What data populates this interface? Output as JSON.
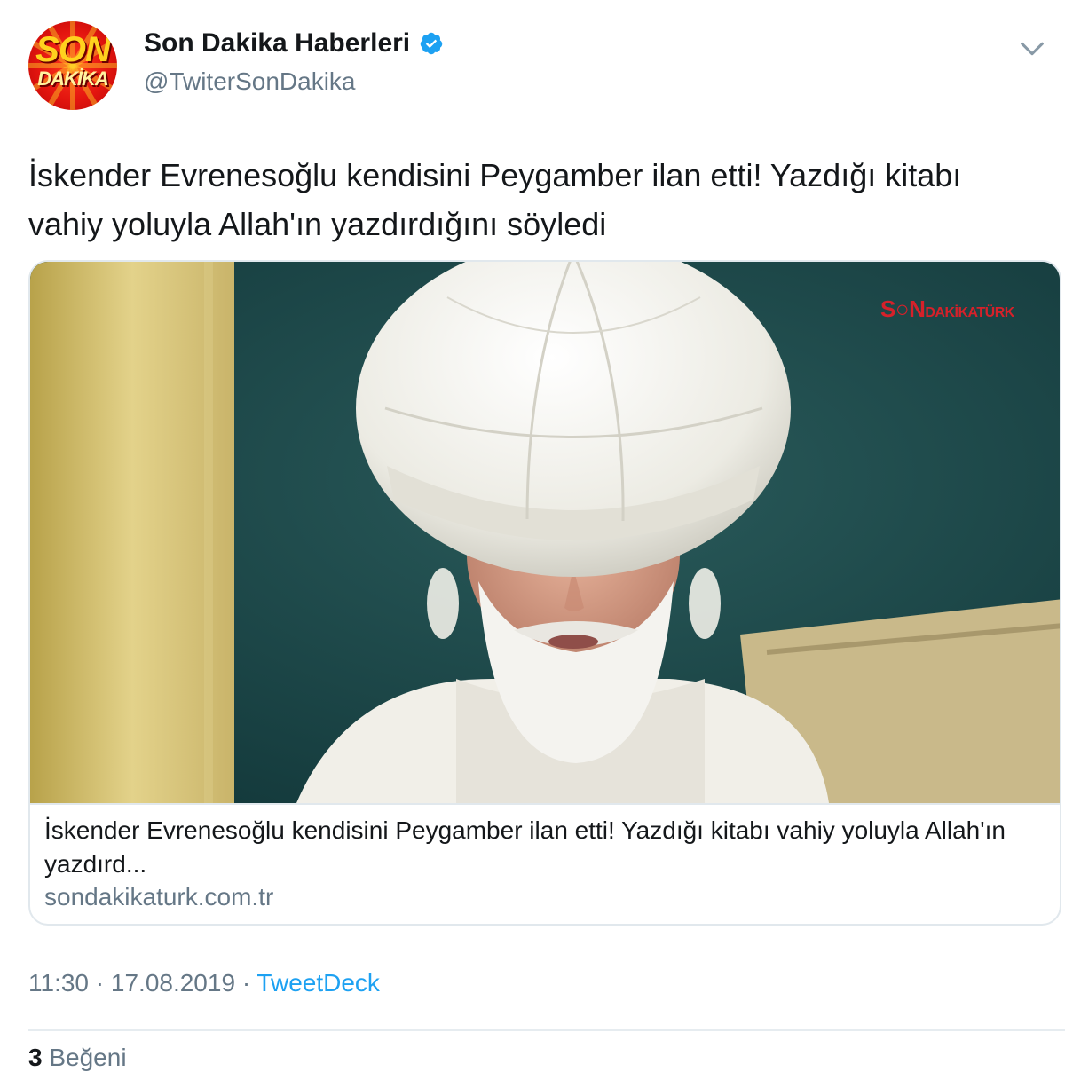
{
  "tweet": {
    "display_name": "Son Dakika Haberleri",
    "handle": "@TwiterSonDakika",
    "avatar_logo": {
      "line1": "SON",
      "line2": "DAKİKA"
    },
    "text": "İskender Evrenesoğlu kendisini Peygamber ilan etti! Yazdığı kitabı vahiy yoluyla Allah'ın yazdırdığını söyledi",
    "time": "11:30",
    "date": "17.08.2019",
    "source": "TweetDeck",
    "separator": "·",
    "likes_count": "3",
    "likes_label": "Beğeni"
  },
  "card": {
    "title": "İskender Evrenesoğlu kendisini Peygamber ilan etti! Yazdığı kitabı vahiy yoluyla Allah'ın yazdırd...",
    "domain": "sondakikaturk.com.tr",
    "watermark": {
      "s": "S",
      "on": "N",
      "rest": "DAKİKATÜRK"
    }
  },
  "icons": {
    "verified": "verified-badge-icon",
    "more": "chevron-down-icon"
  },
  "colors": {
    "accent": "#1da1f2",
    "secondary_text": "#657786",
    "primary_text": "#14171a",
    "border": "#e1e8ed"
  }
}
